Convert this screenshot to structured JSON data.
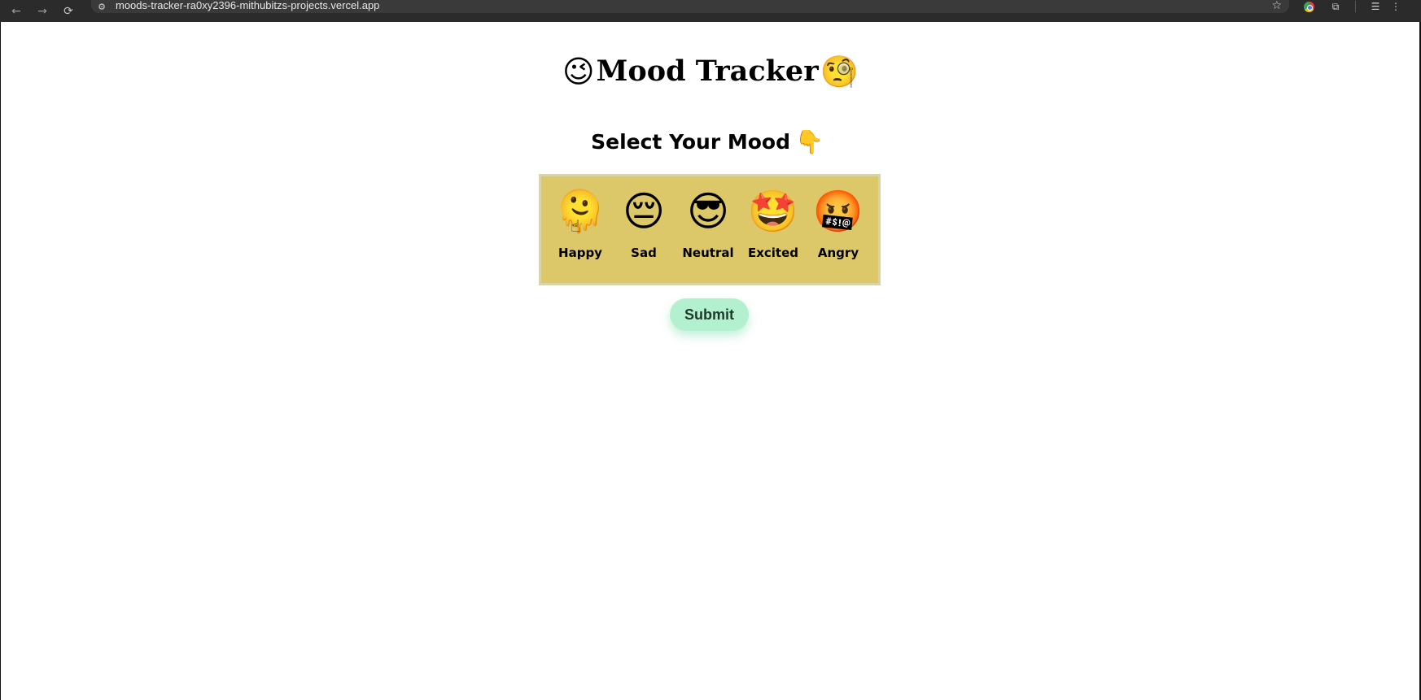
{
  "browser": {
    "url": "moods-tracker-ra0xy2396-mithubitzs-projects.vercel.app",
    "icons": {
      "back": "←",
      "forward": "→",
      "reload": "⟳",
      "site_info": "⚙",
      "bookmark": "☆",
      "extensions": "⧉",
      "profile": "☰",
      "menu": "⋮"
    }
  },
  "header": {
    "title": "Mood Tracker",
    "title_emoji_left": "😉",
    "title_emoji_right": "🧐",
    "subtitle": "Select Your Mood",
    "subtitle_emoji": "👇"
  },
  "moods": [
    {
      "label": "Happy",
      "emoji": "🫠"
    },
    {
      "label": "Sad",
      "emoji": "😔"
    },
    {
      "label": "Neutral",
      "emoji": "😎"
    },
    {
      "label": "Excited",
      "emoji": "🤩"
    },
    {
      "label": "Angry",
      "emoji": "🤬"
    }
  ],
  "actions": {
    "submit_label": "Submit"
  },
  "colors": {
    "panel_bg": "#dcc868",
    "panel_border": "#d6d4a8",
    "submit_bg": "#b2f0cf",
    "chrome_bg": "#2b2b2b"
  }
}
